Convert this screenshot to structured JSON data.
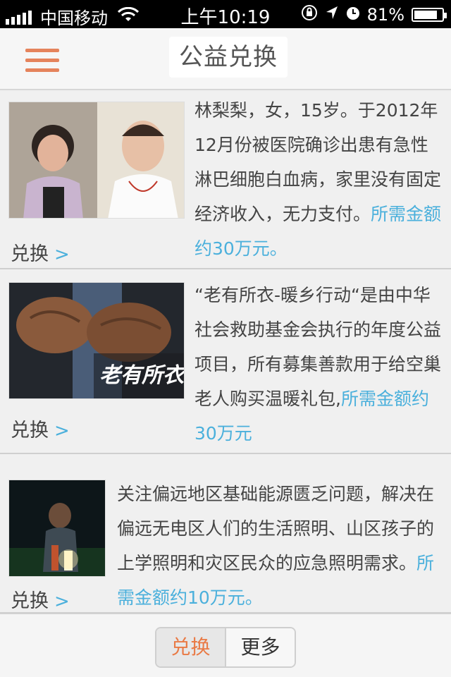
{
  "status_bar": {
    "carrier": "中国移动",
    "time": "上午10:19",
    "battery": "81%"
  },
  "nav": {
    "title": "公益兑换"
  },
  "items": [
    {
      "desc": "林梨梨，女，15岁。于2012年12月份被医院确诊出患有急性淋巴细胞白血病，家里没有固定经济收入，无力支付。",
      "amount": "所需金额约30万元。",
      "exchange": "兑换"
    },
    {
      "desc": "“老有所衣-暖乡行动“是由中华社会救助基金会执行的年度公益项目，所有募集善款用于给空巢老人购买温暖礼包,",
      "amount": "所需金额约30万元",
      "exchange": "兑换",
      "image_text": "老有所衣"
    },
    {
      "desc": "关注偏远地区基础能源匮乏问题，解决在偏远无电区人们的生活照明、山区孩子的上学照明和灾区民众的应急照明需求。",
      "amount": "所需金额约10万元。",
      "exchange": "兑换"
    }
  ],
  "tabs": {
    "exchange": "兑换",
    "more": "更多"
  }
}
